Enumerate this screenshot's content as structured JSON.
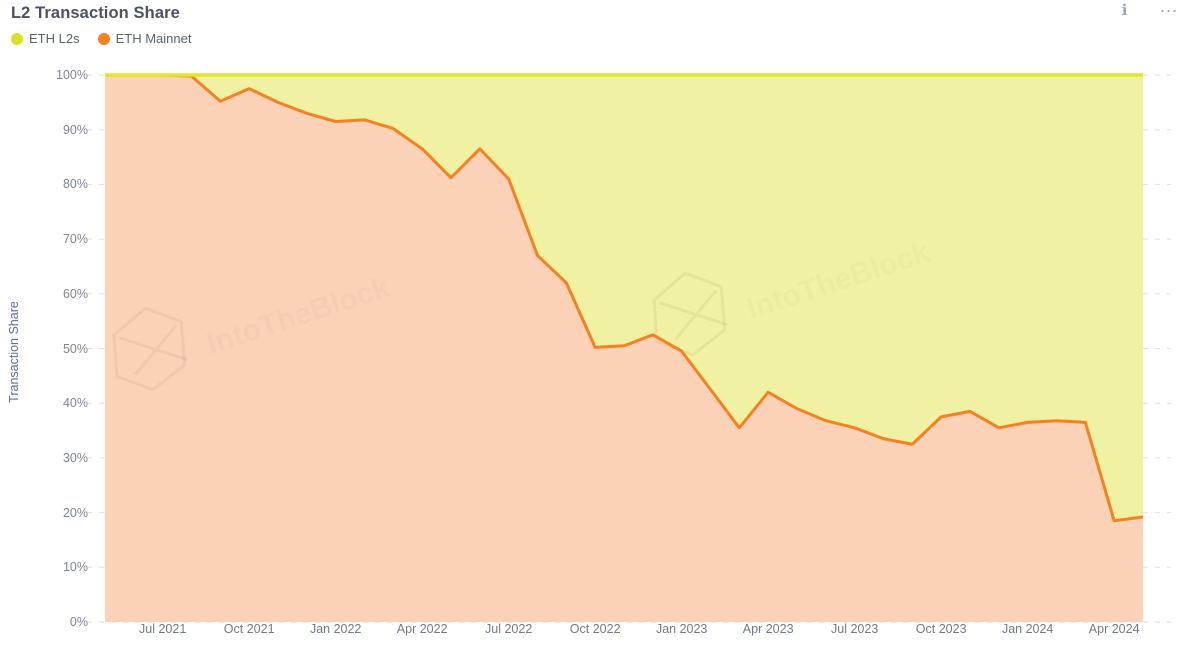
{
  "header": {
    "title": "L2 Transaction Share",
    "info_icon": "info-icon",
    "more_icon": "more-options-icon"
  },
  "legend": {
    "items": [
      {
        "label": "ETH L2s",
        "color": "#d8e022"
      },
      {
        "label": "ETH Mainnet",
        "color": "#f5821f"
      }
    ]
  },
  "watermark": "IntoTheBlock",
  "colors": {
    "l2_area": "#f0f1a3",
    "l2_line": "#e3e629",
    "mainnet_area": "#fbd2b8",
    "mainnet_line": "#f5821f",
    "gridline": "#d9cfc8",
    "axis_label": "#70798e",
    "axis_title": "#5c6ba8",
    "title": "#4a5168"
  },
  "chart_data": {
    "type": "area",
    "title": "L2 Transaction Share",
    "xlabel": "",
    "ylabel": "Transaction Share",
    "ylim": [
      0,
      100
    ],
    "ytick_labels": [
      "0%",
      "10%",
      "20%",
      "30%",
      "40%",
      "50%",
      "60%",
      "70%",
      "80%",
      "90%",
      "100%"
    ],
    "ytick_values": [
      0,
      10,
      20,
      30,
      40,
      50,
      60,
      70,
      80,
      90,
      100
    ],
    "xtick_labels": [
      "Jul 2021",
      "Oct 2021",
      "Jan 2022",
      "Apr 2022",
      "Jul 2022",
      "Oct 2022",
      "Jan 2023",
      "Apr 2023",
      "Jul 2023",
      "Oct 2023",
      "Jan 2024",
      "Apr 2024"
    ],
    "grid": true,
    "legend_position": "top-left",
    "stacked": true,
    "x": [
      "May 2021",
      "Jun 2021",
      "Jul 2021",
      "Aug 2021",
      "Sep 2021",
      "Oct 2021",
      "Nov 2021",
      "Dec 2021",
      "Jan 2022",
      "Feb 2022",
      "Mar 2022",
      "Apr 2022",
      "May 2022",
      "Jun 2022",
      "Jul 2022",
      "Aug 2022",
      "Sep 2022",
      "Oct 2022",
      "Nov 2022",
      "Dec 2022",
      "Jan 2023",
      "Feb 2023",
      "Mar 2023",
      "Apr 2023",
      "May 2023",
      "Jun 2023",
      "Jul 2023",
      "Aug 2023",
      "Sep 2023",
      "Oct 2023",
      "Nov 2023",
      "Dec 2023",
      "Jan 2024",
      "Feb 2024",
      "Mar 2024",
      "Apr 2024",
      "May 2024"
    ],
    "series": [
      {
        "name": "ETH Mainnet",
        "color": "#f5821f",
        "values": [
          100,
          100,
          100,
          99.8,
          95.2,
          97.5,
          95.0,
          93.0,
          91.5,
          91.8,
          90.2,
          86.5,
          81.2,
          86.5,
          81.0,
          67.0,
          62.0,
          50.2,
          50.5,
          52.5,
          49.5,
          42.5,
          35.5,
          42.0,
          39.0,
          36.8,
          35.5,
          33.5,
          32.5,
          37.5,
          38.5,
          35.5,
          36.5,
          36.8,
          36.5,
          18.5,
          19.2
        ]
      },
      {
        "name": "ETH L2s",
        "color": "#d8e022",
        "values": [
          0,
          0,
          0,
          0.2,
          4.8,
          2.5,
          5.0,
          7.0,
          8.5,
          8.2,
          9.8,
          13.5,
          18.8,
          13.5,
          19.0,
          33.0,
          38.0,
          49.8,
          49.5,
          47.5,
          50.5,
          57.5,
          64.5,
          58.0,
          61.0,
          63.2,
          64.5,
          66.5,
          67.5,
          62.5,
          61.5,
          64.5,
          63.5,
          63.2,
          63.5,
          81.5,
          80.8
        ]
      }
    ]
  }
}
